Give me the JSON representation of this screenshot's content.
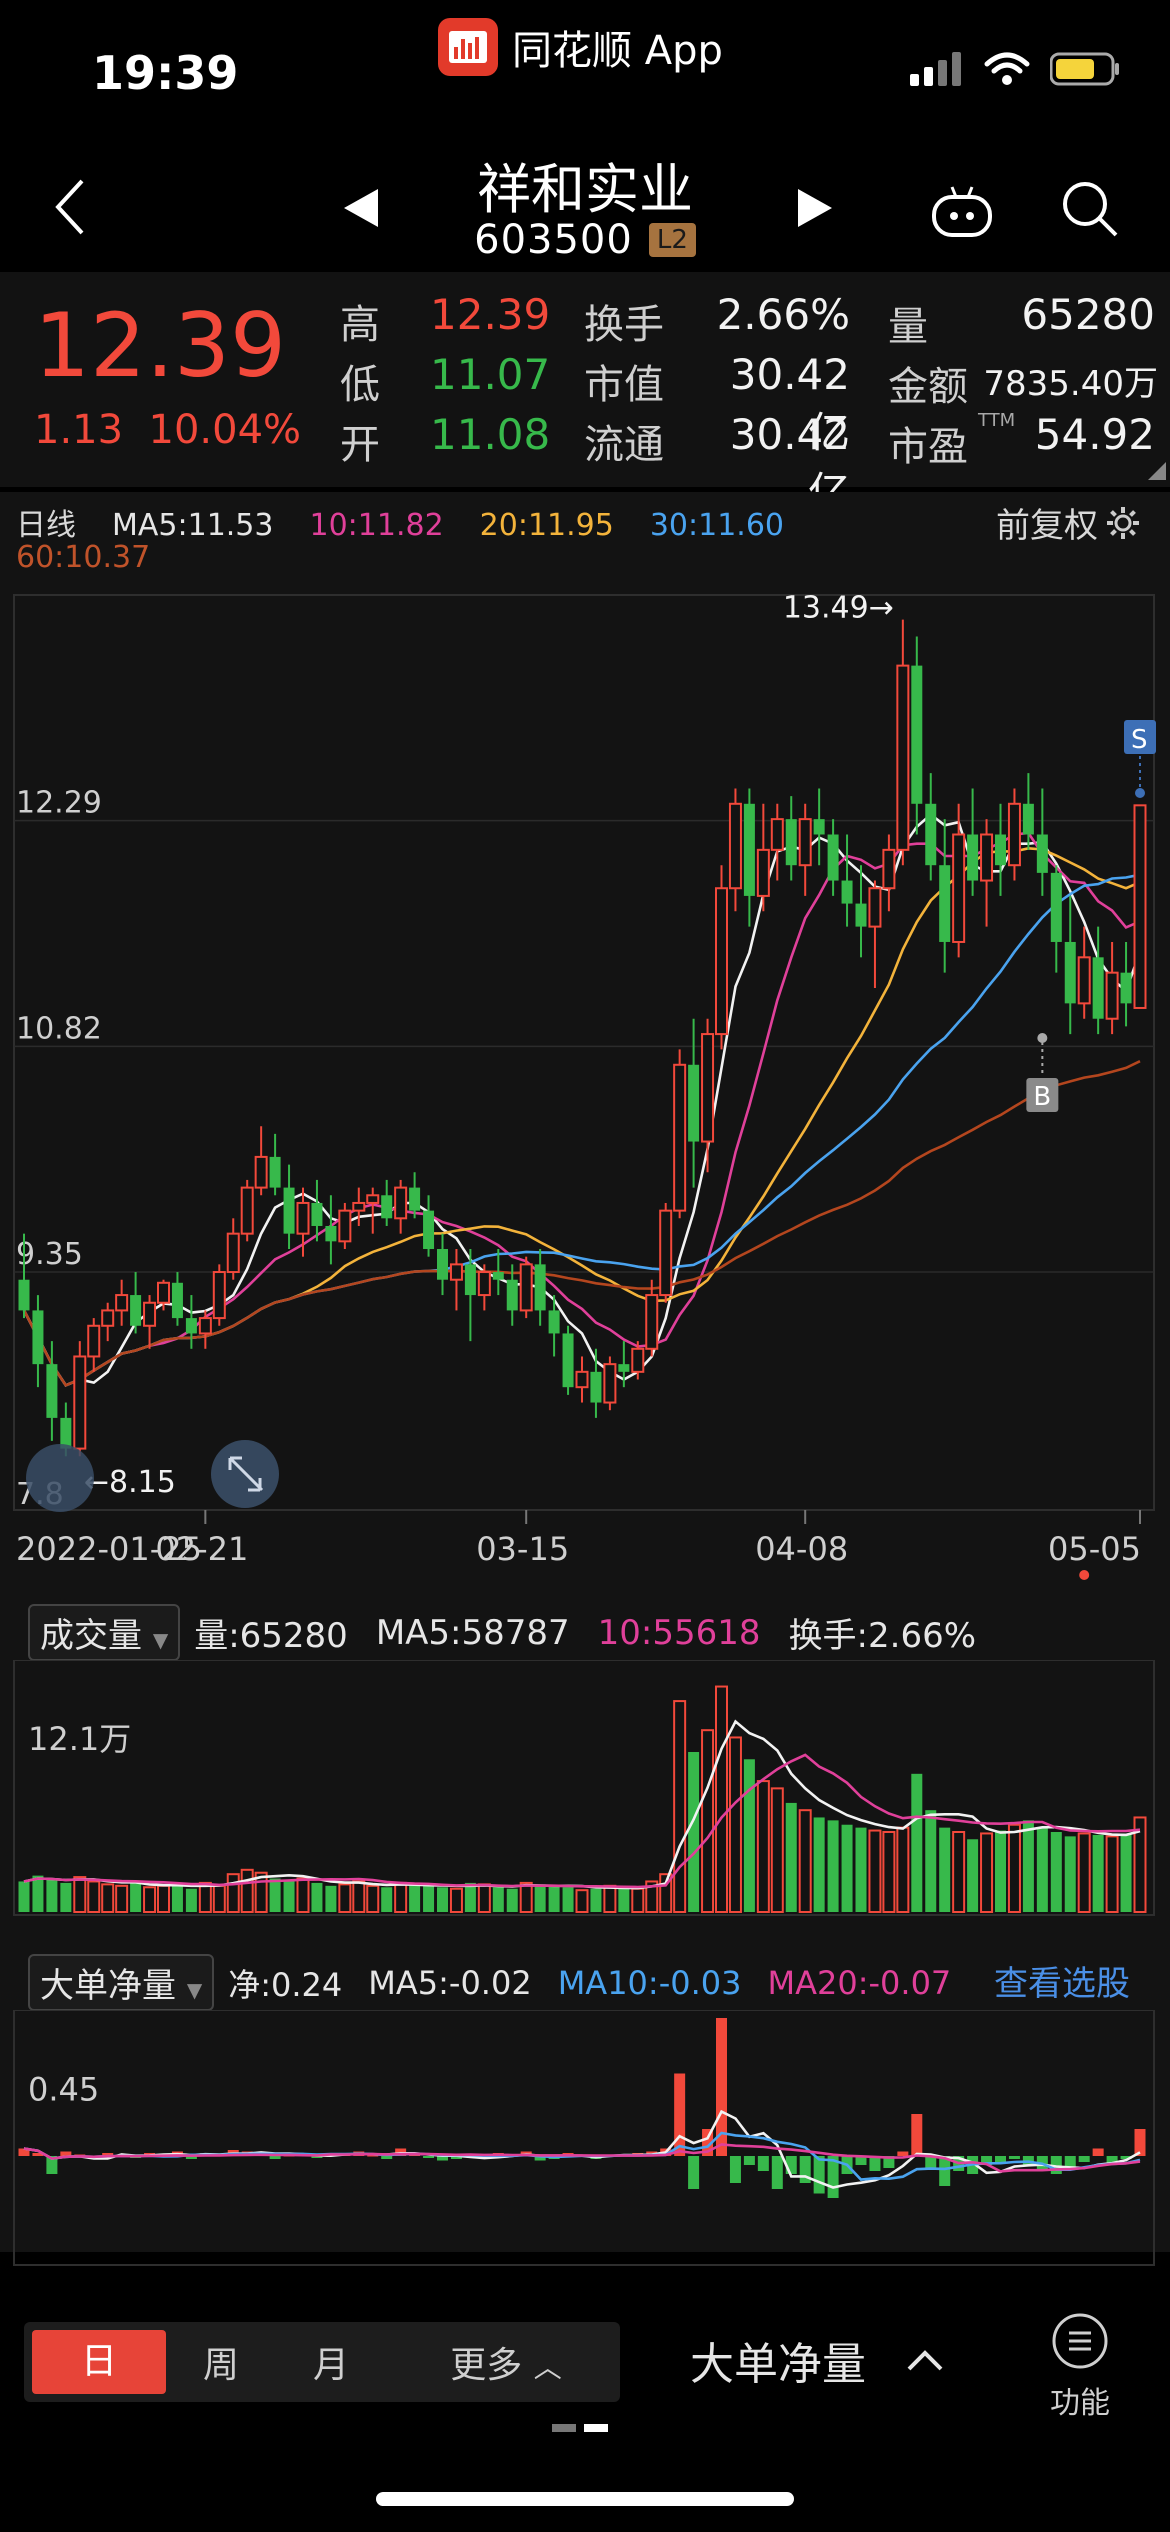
{
  "status_bar": {
    "time": "19:39",
    "app_label": "同花顺 App"
  },
  "header": {
    "stock_name": "祥和实业",
    "stock_code": "603500",
    "level_badge": "L2"
  },
  "quote": {
    "price": "12.39",
    "change": "1.13",
    "change_pct": "10.04%",
    "high_label": "高",
    "high": "12.39",
    "low_label": "低",
    "low": "11.07",
    "open_label": "开",
    "open": "11.08",
    "turnover_label": "换手",
    "turnover": "2.66%",
    "mktcap_label": "市值",
    "mktcap": "30.42亿",
    "float_label": "流通",
    "float_cap": "30.42亿",
    "volume_label": "量",
    "volume": "65280",
    "amount_label": "金额",
    "amount": "7835.40万",
    "pe_label": "市盈",
    "pe_sup": "TTM",
    "pe": "54.92"
  },
  "ma_legend": {
    "period": "日线",
    "ma5": "MA5:11.53",
    "ma10": "10:11.82",
    "ma20": "20:11.95",
    "ma30": "30:11.60",
    "ma60": "60:10.37",
    "adjust": "前复权"
  },
  "colors": {
    "up": "#f2493b",
    "down": "#37b94b",
    "ma5": "#f2f2f2",
    "ma10": "#e0409a",
    "ma20": "#f3b33b",
    "ma30": "#4aa3ef",
    "ma60": "#b4461e",
    "link": "#4a8fe6"
  },
  "chart_data": [
    {
      "type": "candlestick",
      "y_ticks": [
        "13.76",
        "12.29",
        "10.82",
        "9.35",
        "7.8"
      ],
      "x_ticks": [
        "2022-01-25",
        "02-21",
        "03-15",
        "04-08",
        "05-05"
      ],
      "ylim": [
        7.8,
        13.76
      ],
      "annotations": {
        "high": "13.49→",
        "low": "←8.15",
        "sell": "S",
        "buy": "B"
      },
      "ohlc": [
        [
          9.3,
          9.6,
          9.05,
          9.1
        ],
        [
          9.1,
          9.2,
          8.6,
          8.75
        ],
        [
          8.75,
          8.9,
          8.25,
          8.4
        ],
        [
          8.4,
          8.5,
          8.15,
          8.2
        ],
        [
          8.2,
          8.9,
          8.15,
          8.8
        ],
        [
          8.8,
          9.05,
          8.7,
          9.0
        ],
        [
          9.0,
          9.15,
          8.9,
          9.1
        ],
        [
          9.1,
          9.3,
          9.0,
          9.2
        ],
        [
          9.2,
          9.35,
          8.95,
          9.0
        ],
        [
          9.0,
          9.2,
          8.85,
          9.15
        ],
        [
          9.15,
          9.3,
          9.1,
          9.28
        ],
        [
          9.28,
          9.35,
          9.0,
          9.05
        ],
        [
          9.05,
          9.2,
          8.85,
          8.95
        ],
        [
          8.95,
          9.1,
          8.85,
          9.05
        ],
        [
          9.05,
          9.4,
          9.0,
          9.35
        ],
        [
          9.35,
          9.7,
          9.3,
          9.6
        ],
        [
          9.6,
          9.95,
          9.55,
          9.9
        ],
        [
          9.9,
          10.3,
          9.85,
          10.1
        ],
        [
          10.1,
          10.25,
          9.85,
          9.9
        ],
        [
          9.9,
          10.05,
          9.5,
          9.6
        ],
        [
          9.6,
          9.9,
          9.45,
          9.8
        ],
        [
          9.8,
          9.95,
          9.55,
          9.65
        ],
        [
          9.65,
          9.85,
          9.4,
          9.55
        ],
        [
          9.55,
          9.8,
          9.5,
          9.75
        ],
        [
          9.75,
          9.9,
          9.65,
          9.8
        ],
        [
          9.8,
          9.9,
          9.6,
          9.85
        ],
        [
          9.85,
          9.95,
          9.65,
          9.7
        ],
        [
          9.7,
          9.95,
          9.6,
          9.9
        ],
        [
          9.9,
          10.0,
          9.7,
          9.75
        ],
        [
          9.75,
          9.85,
          9.45,
          9.5
        ],
        [
          9.5,
          9.6,
          9.2,
          9.3
        ],
        [
          9.3,
          9.5,
          9.1,
          9.4
        ],
        [
          9.4,
          9.5,
          8.9,
          9.2
        ],
        [
          9.2,
          9.4,
          9.1,
          9.35
        ],
        [
          9.35,
          9.5,
          9.2,
          9.3
        ],
        [
          9.3,
          9.4,
          9.0,
          9.1
        ],
        [
          9.1,
          9.45,
          9.05,
          9.4
        ],
        [
          9.4,
          9.5,
          9.0,
          9.1
        ],
        [
          9.1,
          9.2,
          8.8,
          8.95
        ],
        [
          8.95,
          9.0,
          8.55,
          8.6
        ],
        [
          8.6,
          8.8,
          8.5,
          8.7
        ],
        [
          8.7,
          8.85,
          8.4,
          8.5
        ],
        [
          8.5,
          8.8,
          8.45,
          8.75
        ],
        [
          8.75,
          8.9,
          8.6,
          8.7
        ],
        [
          8.7,
          8.9,
          8.65,
          8.85
        ],
        [
          8.85,
          9.3,
          8.8,
          9.2
        ],
        [
          9.2,
          9.8,
          9.15,
          9.75
        ],
        [
          9.75,
          10.8,
          9.7,
          10.7
        ],
        [
          10.7,
          11.0,
          9.9,
          10.2
        ],
        [
          10.2,
          11.0,
          10.0,
          10.9
        ],
        [
          10.9,
          12.0,
          10.8,
          11.85
        ],
        [
          11.85,
          12.5,
          11.7,
          12.4
        ],
        [
          12.4,
          12.5,
          11.6,
          11.8
        ],
        [
          11.8,
          12.4,
          11.7,
          12.1
        ],
        [
          12.1,
          12.4,
          11.9,
          12.3
        ],
        [
          12.3,
          12.45,
          11.9,
          12.0
        ],
        [
          12.0,
          12.4,
          11.8,
          12.3
        ],
        [
          12.3,
          12.5,
          12.0,
          12.2
        ],
        [
          12.2,
          12.3,
          11.8,
          11.9
        ],
        [
          11.9,
          12.2,
          11.6,
          11.75
        ],
        [
          11.75,
          12.0,
          11.4,
          11.6
        ],
        [
          11.6,
          11.9,
          11.2,
          11.85
        ],
        [
          11.85,
          12.2,
          11.7,
          12.1
        ],
        [
          12.1,
          13.6,
          12.0,
          13.3
        ],
        [
          13.3,
          13.49,
          12.2,
          12.4
        ],
        [
          12.4,
          12.6,
          11.9,
          12.0
        ],
        [
          12.0,
          12.3,
          11.3,
          11.5
        ],
        [
          11.5,
          12.4,
          11.4,
          12.2
        ],
        [
          12.2,
          12.5,
          11.8,
          11.9
        ],
        [
          11.9,
          12.3,
          11.6,
          12.2
        ],
        [
          12.2,
          12.4,
          11.8,
          12.0
        ],
        [
          12.0,
          12.5,
          11.9,
          12.4
        ],
        [
          12.4,
          12.6,
          12.1,
          12.2
        ],
        [
          12.2,
          12.5,
          11.8,
          11.95
        ],
        [
          11.95,
          12.0,
          11.3,
          11.5
        ],
        [
          11.5,
          11.8,
          10.9,
          11.1
        ],
        [
          11.1,
          11.6,
          11.0,
          11.4
        ],
        [
          11.4,
          11.6,
          10.9,
          11.0
        ],
        [
          11.0,
          11.5,
          10.9,
          11.3
        ],
        [
          11.3,
          11.5,
          10.95,
          11.1
        ],
        [
          11.07,
          12.39,
          11.07,
          12.39
        ]
      ]
    },
    {
      "type": "bar",
      "title": "成交量",
      "volume": "量:65280",
      "ma5": "MA5:58787",
      "ma10": "10:55618",
      "turnover": "换手:2.66%",
      "y_tick": "12.1万",
      "values": [
        2.1,
        2.5,
        2.2,
        2.0,
        2.4,
        2.1,
        1.9,
        1.8,
        2.0,
        1.7,
        1.8,
        1.9,
        1.6,
        2.0,
        1.8,
        2.6,
        2.9,
        2.7,
        2.3,
        2.1,
        2.3,
        2.0,
        1.8,
        1.9,
        2.1,
        1.8,
        1.7,
        2.0,
        1.8,
        1.9,
        1.7,
        1.6,
        2.0,
        1.9,
        1.7,
        1.6,
        2.0,
        1.9,
        1.8,
        1.7,
        1.5,
        1.6,
        1.8,
        1.7,
        1.6,
        2.1,
        2.6,
        14.5,
        11.0,
        12.5,
        15.5,
        12.0,
        10.5,
        9.0,
        8.5,
        7.5,
        7.0,
        6.5,
        6.3,
        6.0,
        5.8,
        5.6,
        5.5,
        5.8,
        9.5,
        7.0,
        5.8,
        5.5,
        5.0,
        5.4,
        5.6,
        6.0,
        6.3,
        5.8,
        5.5,
        5.2,
        5.4,
        5.3,
        5.2,
        5.4,
        6.5
      ],
      "colors_up": true
    },
    {
      "type": "bar",
      "title": "大单净量",
      "net": "净:0.24",
      "ma5": "MA5:-0.02",
      "ma10": "MA10:-0.03",
      "ma20": "MA20:-0.07",
      "link": "查看选股",
      "y_tick": "0.45",
      "values": [
        0.05,
        0.02,
        -0.12,
        0.03,
        0.01,
        -0.02,
        0.02,
        0.01,
        -0.01,
        0.02,
        0.01,
        0.03,
        -0.02,
        0.02,
        0.01,
        0.04,
        0.03,
        0.02,
        -0.02,
        0.01,
        0.02,
        -0.01,
        0.01,
        0.02,
        0.03,
        0.01,
        -0.02,
        0.05,
        0.02,
        -0.01,
        -0.03,
        -0.02,
        0.01,
        -0.02,
        0.02,
        0.01,
        0.03,
        -0.03,
        -0.02,
        0.02,
        0.01,
        -0.02,
        0.01,
        0.01,
        0.02,
        0.03,
        0.05,
        0.55,
        -0.22,
        0.18,
        0.92,
        -0.18,
        -0.06,
        -0.1,
        -0.22,
        -0.12,
        -0.18,
        -0.25,
        -0.28,
        -0.12,
        -0.06,
        -0.1,
        -0.08,
        0.03,
        0.28,
        -0.08,
        -0.2,
        -0.1,
        -0.12,
        -0.06,
        -0.05,
        -0.02,
        -0.06,
        -0.1,
        -0.12,
        -0.08,
        -0.04,
        0.05,
        -0.05,
        -0.02,
        0.18
      ]
    }
  ],
  "bottom": {
    "periods": [
      "日",
      "周",
      "月",
      "更多"
    ],
    "indicator": "大单净量",
    "function_label": "功能"
  }
}
